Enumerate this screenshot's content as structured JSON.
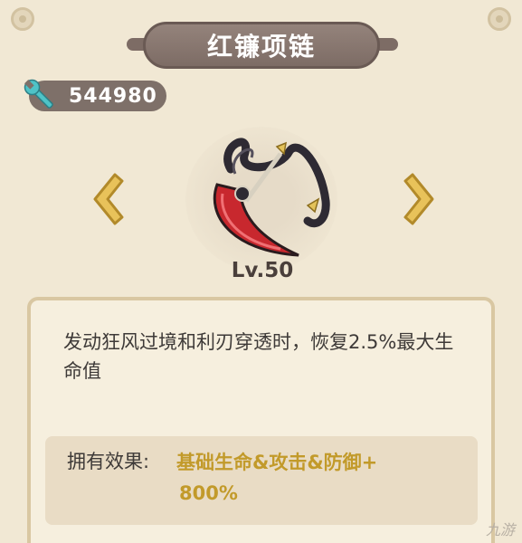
{
  "title": "红镰项链",
  "currency": {
    "icon": "wrench-icon",
    "value": "544980"
  },
  "item": {
    "level": "Lv.50"
  },
  "description": "发动狂风过境和利刃穿透时，恢复2.5%最大生命值",
  "effect": {
    "label": "拥有效果:",
    "value_line1": "基础生命&攻击&防御+",
    "value_line2": "800%"
  },
  "watermark": "九游",
  "colors": {
    "accent_gold": "#c29a2a",
    "plaque": "#7d6c65",
    "arrow": "#e0b848"
  }
}
